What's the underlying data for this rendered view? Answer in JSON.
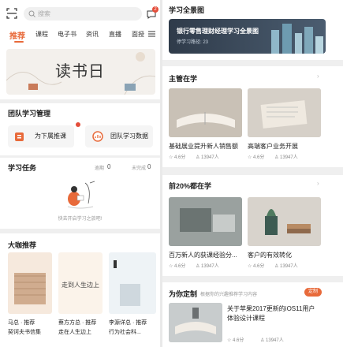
{
  "left": {
    "search_placeholder": "搜索",
    "notif_count": "2",
    "tabs": [
      "推荐",
      "课程",
      "电子书",
      "资讯",
      "直播",
      "面授"
    ],
    "banner_title": "读书日",
    "team": {
      "title": "团队学习管理",
      "assign_label": "为下属推课",
      "data_label": "团队学习数据"
    },
    "tasks": {
      "title": "学习任务",
      "overdue_label": "逾期",
      "overdue_count": "0",
      "unfinished_label": "未完成",
      "unfinished_count": "0",
      "empty_text": "快去开启学习之旅吧!"
    },
    "bigshot": {
      "title": "大咖推荐",
      "items": [
        {
          "who": "马总 · 推荐",
          "book": "契诃夫书信集"
        },
        {
          "who": "蔡方方总 · 推荐",
          "book": "走在人生边上"
        },
        {
          "who": "李源详总 · 推荐",
          "book": "行为社会科..."
        }
      ],
      "cover2_text": "走到人生边上"
    }
  },
  "right": {
    "panorama": {
      "title": "学习全景图",
      "card_title": "银行零售理财经理学习全景图",
      "card_sub": "停学习路径: 23"
    },
    "manager": {
      "title": "主管在学",
      "items": [
        {
          "name": "基础展业提升新人销售额",
          "score": "4.6分",
          "people": "13947人"
        },
        {
          "name": "高端客户业务开展",
          "score": "4.6分",
          "people": "13947人"
        }
      ]
    },
    "top20": {
      "title": "前20%都在学",
      "items": [
        {
          "name": "百万新人的获课经验分...",
          "score": "4.6分",
          "people": "13947人"
        },
        {
          "name": "客户的有效转化",
          "score": "4.6分",
          "people": "13947人"
        }
      ]
    },
    "custom": {
      "title": "为你定制",
      "subtitle": "根据你的兴趣推荐学习内容",
      "badge": "定制",
      "item": {
        "name_line1": "关于苹果2017更新的iOS11用户",
        "name_line2": "体验设计课程",
        "score": "4.6分",
        "people": "13947人"
      }
    },
    "more_glyph": "›"
  },
  "colors": {
    "accent": "#e86a3a",
    "badge": "#e44d3a",
    "card_dark": "#3a4a5c"
  }
}
